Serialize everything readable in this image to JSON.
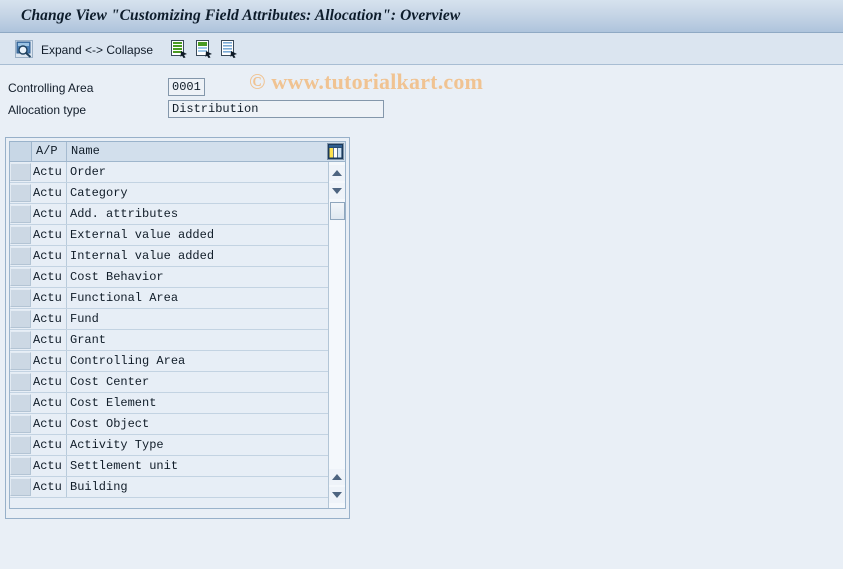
{
  "window": {
    "title": "Change View \"Customizing Field Attributes: Allocation\": Overview"
  },
  "toolbar": {
    "icons": [
      {
        "name": "search-details-icon",
        "glyph": "magnifier"
      },
      {
        "name": "expand-collapse-green-icon",
        "glyph": "doc-green"
      },
      {
        "name": "select-all-green-icon",
        "glyph": "doc-green-check"
      },
      {
        "name": "deselect-all-icon",
        "glyph": "doc-blue"
      }
    ],
    "expand_collapse_label": "Expand <-> Collapse",
    "watermark": "© www.tutorialkart.com"
  },
  "form": {
    "controlling_area": {
      "label": "Controlling Area",
      "value": "0001",
      "placeholder": ""
    },
    "allocation_type": {
      "label": "Allocation type",
      "value": "Distribution",
      "placeholder": ""
    }
  },
  "table": {
    "columns": [
      {
        "key": "ap",
        "label": "A/P"
      },
      {
        "key": "name",
        "label": "Name"
      }
    ],
    "config_icon": "column-settings-icon",
    "rows": [
      {
        "ap": "Actu",
        "name": "Order"
      },
      {
        "ap": "Actu",
        "name": "Category"
      },
      {
        "ap": "Actu",
        "name": "Add. attributes"
      },
      {
        "ap": "Actu",
        "name": "External value added"
      },
      {
        "ap": "Actu",
        "name": "Internal value added"
      },
      {
        "ap": "Actu",
        "name": "Cost Behavior"
      },
      {
        "ap": "Actu",
        "name": "Functional Area"
      },
      {
        "ap": "Actu",
        "name": "Fund"
      },
      {
        "ap": "Actu",
        "name": "Grant"
      },
      {
        "ap": "Actu",
        "name": "Controlling Area"
      },
      {
        "ap": "Actu",
        "name": "Cost Center"
      },
      {
        "ap": "Actu",
        "name": "Cost Element"
      },
      {
        "ap": "Actu",
        "name": "Cost Object"
      },
      {
        "ap": "Actu",
        "name": "Activity Type"
      },
      {
        "ap": "Actu",
        "name": "Settlement unit"
      },
      {
        "ap": "Actu",
        "name": "Building"
      }
    ]
  },
  "colors": {
    "page_background": "#e9eff6",
    "titlebar_top": "#d6e2ee",
    "titlebar_bottom": "#aec4dc",
    "toolbar_background": "#dbe5f0",
    "watermark_text": "#f0c392",
    "table_row_background": "#e7eef6",
    "table_header_background": "#d2dfec",
    "border": "#97b0c9"
  }
}
